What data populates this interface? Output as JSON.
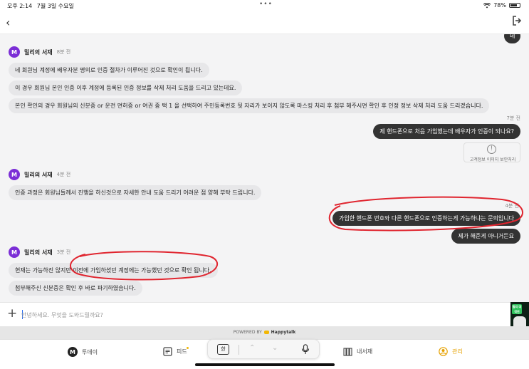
{
  "status_bar": {
    "time": "오후 2:14",
    "date": "7월 3일 수요일",
    "wifi_icon": "wifi-icon",
    "battery": "78%",
    "battery_level": 0.78
  },
  "nav": {
    "back_icon": "chevron-left-icon",
    "exit_icon": "exit-icon"
  },
  "chat": {
    "partial_label": "네",
    "group1": {
      "sender": "밀리의 서재",
      "time": "8분 전",
      "messages": [
        "네 회원님 계정에 배우자분 명의로 인증 절차가 이루어진 것으로 확인이 됩니다.",
        "이 경우 회원님 본인 인증 이후 계정에 등록된 인증 정보를 삭제 처리 도움을 드리고 있는데요.",
        "본인 확인의 경우 회원님의 신분증 or 운전 면허증 or 여권 중 택 1 을 선택하여 주민등록번호 뒷 자리가 보이지 않도록 마스킹 처리 후 첨부 해주시면 확인 후 인정 정보 삭제 처리 도움 드리겠습니다."
      ]
    },
    "user1": {
      "time": "7분 전",
      "message": "제 핸드폰으로 처음 가입했는데 배우자가 인증이 되나요?"
    },
    "notice": {
      "icon": "exclamation-circle-icon",
      "text": "고객정보 이미지 보안처리"
    },
    "group2": {
      "sender": "밀리의 서재",
      "time": "4분 전",
      "messages": [
        "인증 과정은 회원님들께서 진행을 하신것으로 자세한 안내 도움 드리기 어려운 점 양해 부탁 드립니다."
      ]
    },
    "user2": {
      "time": "4분 전",
      "messages": [
        "가입한 핸드폰 번호와 다른 핸드폰으로 인증하는게 가능하냐는 문의입니다",
        "제가 해준게 아니거든요"
      ]
    },
    "group3": {
      "sender": "밀리의 서재",
      "time": "3분 전",
      "messages": [
        "현재는 가능하진 않지만 이전에 가입하셨던 계정에는 가능했던 것으로 확인 됩니다.",
        "첨부해주신 신분증은 확인 후 바로 파기하였습니다."
      ]
    }
  },
  "input": {
    "plus": "+",
    "placeholder": "안녕하세요. 무엇을 도와드릴까요?"
  },
  "ad": {
    "label": "밀리 대작전"
  },
  "powered": {
    "prefix": "POWERED BY",
    "brand": "Happytalk"
  },
  "tabs": [
    {
      "label": "투데이",
      "icon": "today-logo-icon"
    },
    {
      "label": "피드",
      "icon": "feed-icon"
    },
    {
      "label": "내서재",
      "icon": "library-icon"
    },
    {
      "label": "관리",
      "icon": "profile-icon"
    }
  ],
  "keyboard": {
    "lang_key": "한",
    "up_icon": "chevron-up-icon",
    "down_icon": "chevron-down-icon",
    "mic_icon": "mic-icon"
  },
  "colors": {
    "brand_purple": "#7b2ed6",
    "bubble_dark": "#333333",
    "bubble_light": "#e7e7e9",
    "active_tab": "#e6a100",
    "annotation_red": "#e0252f"
  }
}
